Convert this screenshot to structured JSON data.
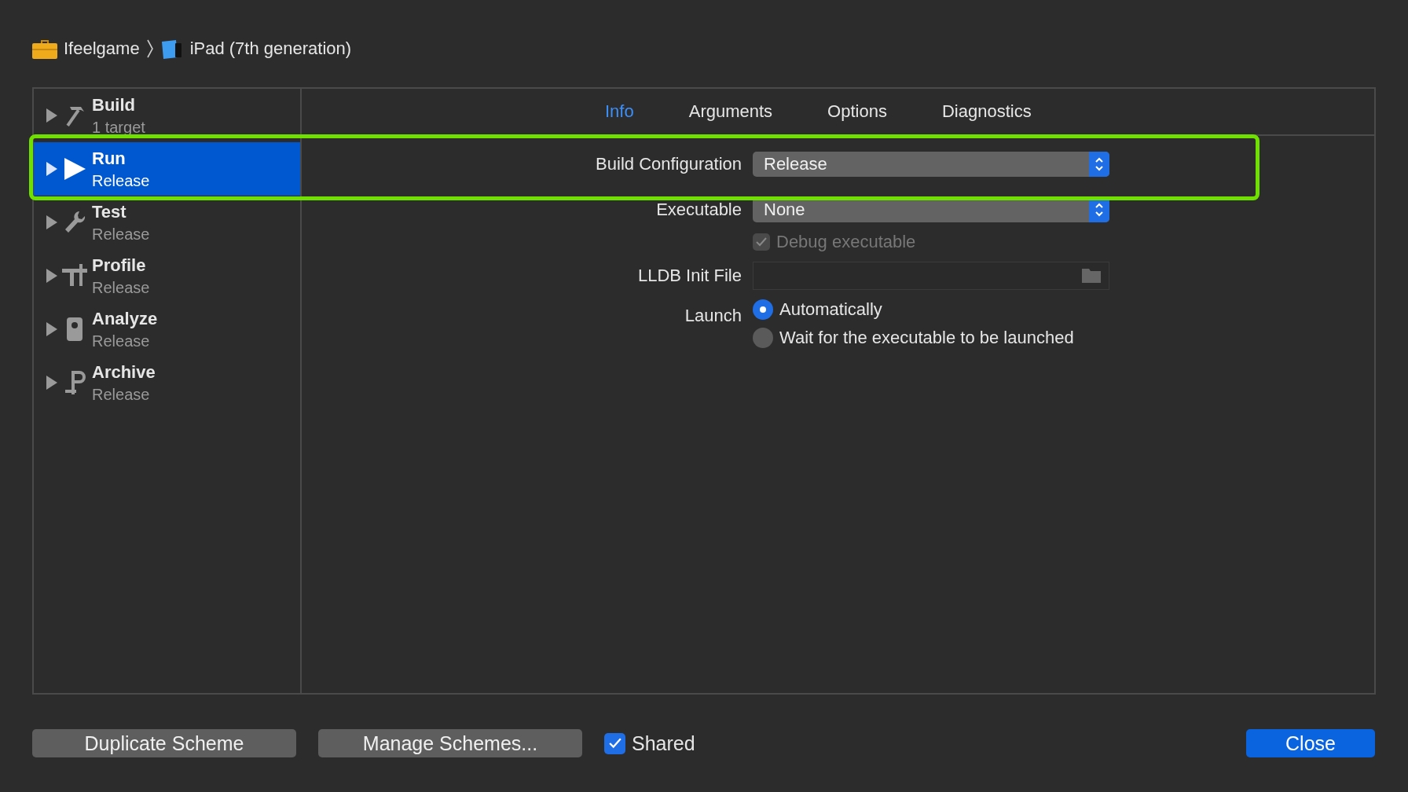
{
  "breadcrumb": [
    {
      "kind": "project",
      "label": "Ifeelgame"
    },
    {
      "kind": "device",
      "label": "iPad (7th generation)"
    }
  ],
  "actions": [
    {
      "kind": "build",
      "title": "Build",
      "subtitle": "1 target",
      "selected": false
    },
    {
      "kind": "run",
      "title": "Run",
      "subtitle": "Release",
      "selected": true
    },
    {
      "kind": "test",
      "title": "Test",
      "subtitle": "Release",
      "selected": false
    },
    {
      "kind": "profile",
      "title": "Profile",
      "subtitle": "Release",
      "selected": false
    },
    {
      "kind": "analyze",
      "title": "Analyze",
      "subtitle": "Release",
      "selected": false
    },
    {
      "kind": "archive",
      "title": "Archive",
      "subtitle": "Release",
      "selected": false
    }
  ],
  "tabs": [
    {
      "label": "Info",
      "selected": true
    },
    {
      "label": "Arguments",
      "selected": false
    },
    {
      "label": "Options",
      "selected": false
    },
    {
      "label": "Diagnostics",
      "selected": false
    }
  ],
  "form": {
    "build_configuration": {
      "label": "Build Configuration",
      "value": "Release"
    },
    "executable": {
      "label": "Executable",
      "value": "None"
    },
    "debug_executable": {
      "label": "Debug executable",
      "checked": true,
      "disabled": true
    },
    "lldb_init_file": {
      "label": "LLDB Init File"
    },
    "launch": {
      "label": "Launch",
      "options": [
        {
          "label": "Automatically",
          "selected": true
        },
        {
          "label": "Wait for the executable to be launched",
          "selected": false
        }
      ]
    }
  },
  "footer": {
    "duplicate": "Duplicate Scheme",
    "manage": "Manage Schemes...",
    "shared": {
      "label": "Shared",
      "checked": true
    },
    "close": "Close"
  }
}
